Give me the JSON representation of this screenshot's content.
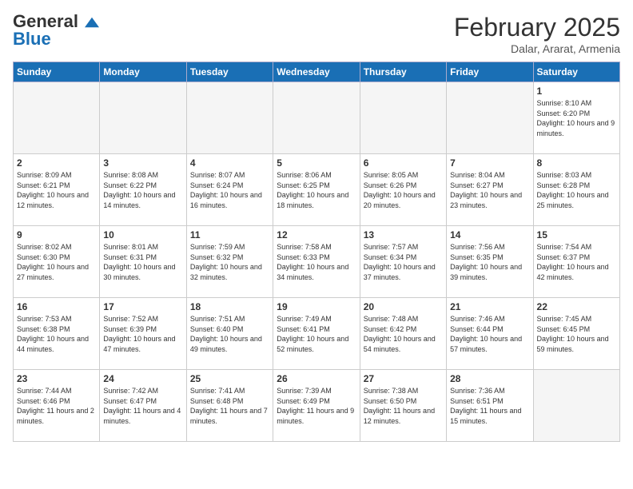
{
  "header": {
    "logo_general": "General",
    "logo_blue": "Blue",
    "month_title": "February 2025",
    "location": "Dalar, Ararat, Armenia"
  },
  "days_of_week": [
    "Sunday",
    "Monday",
    "Tuesday",
    "Wednesday",
    "Thursday",
    "Friday",
    "Saturday"
  ],
  "weeks": [
    [
      {
        "day": "",
        "empty": true
      },
      {
        "day": "",
        "empty": true
      },
      {
        "day": "",
        "empty": true
      },
      {
        "day": "",
        "empty": true
      },
      {
        "day": "",
        "empty": true
      },
      {
        "day": "",
        "empty": true
      },
      {
        "day": "1",
        "sunrise": "8:10 AM",
        "sunset": "6:20 PM",
        "daylight": "10 hours and 9 minutes."
      }
    ],
    [
      {
        "day": "2",
        "sunrise": "8:09 AM",
        "sunset": "6:21 PM",
        "daylight": "10 hours and 12 minutes."
      },
      {
        "day": "3",
        "sunrise": "8:08 AM",
        "sunset": "6:22 PM",
        "daylight": "10 hours and 14 minutes."
      },
      {
        "day": "4",
        "sunrise": "8:07 AM",
        "sunset": "6:24 PM",
        "daylight": "10 hours and 16 minutes."
      },
      {
        "day": "5",
        "sunrise": "8:06 AM",
        "sunset": "6:25 PM",
        "daylight": "10 hours and 18 minutes."
      },
      {
        "day": "6",
        "sunrise": "8:05 AM",
        "sunset": "6:26 PM",
        "daylight": "10 hours and 20 minutes."
      },
      {
        "day": "7",
        "sunrise": "8:04 AM",
        "sunset": "6:27 PM",
        "daylight": "10 hours and 23 minutes."
      },
      {
        "day": "8",
        "sunrise": "8:03 AM",
        "sunset": "6:28 PM",
        "daylight": "10 hours and 25 minutes."
      }
    ],
    [
      {
        "day": "9",
        "sunrise": "8:02 AM",
        "sunset": "6:30 PM",
        "daylight": "10 hours and 27 minutes."
      },
      {
        "day": "10",
        "sunrise": "8:01 AM",
        "sunset": "6:31 PM",
        "daylight": "10 hours and 30 minutes."
      },
      {
        "day": "11",
        "sunrise": "7:59 AM",
        "sunset": "6:32 PM",
        "daylight": "10 hours and 32 minutes."
      },
      {
        "day": "12",
        "sunrise": "7:58 AM",
        "sunset": "6:33 PM",
        "daylight": "10 hours and 34 minutes."
      },
      {
        "day": "13",
        "sunrise": "7:57 AM",
        "sunset": "6:34 PM",
        "daylight": "10 hours and 37 minutes."
      },
      {
        "day": "14",
        "sunrise": "7:56 AM",
        "sunset": "6:35 PM",
        "daylight": "10 hours and 39 minutes."
      },
      {
        "day": "15",
        "sunrise": "7:54 AM",
        "sunset": "6:37 PM",
        "daylight": "10 hours and 42 minutes."
      }
    ],
    [
      {
        "day": "16",
        "sunrise": "7:53 AM",
        "sunset": "6:38 PM",
        "daylight": "10 hours and 44 minutes."
      },
      {
        "day": "17",
        "sunrise": "7:52 AM",
        "sunset": "6:39 PM",
        "daylight": "10 hours and 47 minutes."
      },
      {
        "day": "18",
        "sunrise": "7:51 AM",
        "sunset": "6:40 PM",
        "daylight": "10 hours and 49 minutes."
      },
      {
        "day": "19",
        "sunrise": "7:49 AM",
        "sunset": "6:41 PM",
        "daylight": "10 hours and 52 minutes."
      },
      {
        "day": "20",
        "sunrise": "7:48 AM",
        "sunset": "6:42 PM",
        "daylight": "10 hours and 54 minutes."
      },
      {
        "day": "21",
        "sunrise": "7:46 AM",
        "sunset": "6:44 PM",
        "daylight": "10 hours and 57 minutes."
      },
      {
        "day": "22",
        "sunrise": "7:45 AM",
        "sunset": "6:45 PM",
        "daylight": "10 hours and 59 minutes."
      }
    ],
    [
      {
        "day": "23",
        "sunrise": "7:44 AM",
        "sunset": "6:46 PM",
        "daylight": "11 hours and 2 minutes."
      },
      {
        "day": "24",
        "sunrise": "7:42 AM",
        "sunset": "6:47 PM",
        "daylight": "11 hours and 4 minutes."
      },
      {
        "day": "25",
        "sunrise": "7:41 AM",
        "sunset": "6:48 PM",
        "daylight": "11 hours and 7 minutes."
      },
      {
        "day": "26",
        "sunrise": "7:39 AM",
        "sunset": "6:49 PM",
        "daylight": "11 hours and 9 minutes."
      },
      {
        "day": "27",
        "sunrise": "7:38 AM",
        "sunset": "6:50 PM",
        "daylight": "11 hours and 12 minutes."
      },
      {
        "day": "28",
        "sunrise": "7:36 AM",
        "sunset": "6:51 PM",
        "daylight": "11 hours and 15 minutes."
      },
      {
        "day": "",
        "empty": true
      }
    ]
  ]
}
